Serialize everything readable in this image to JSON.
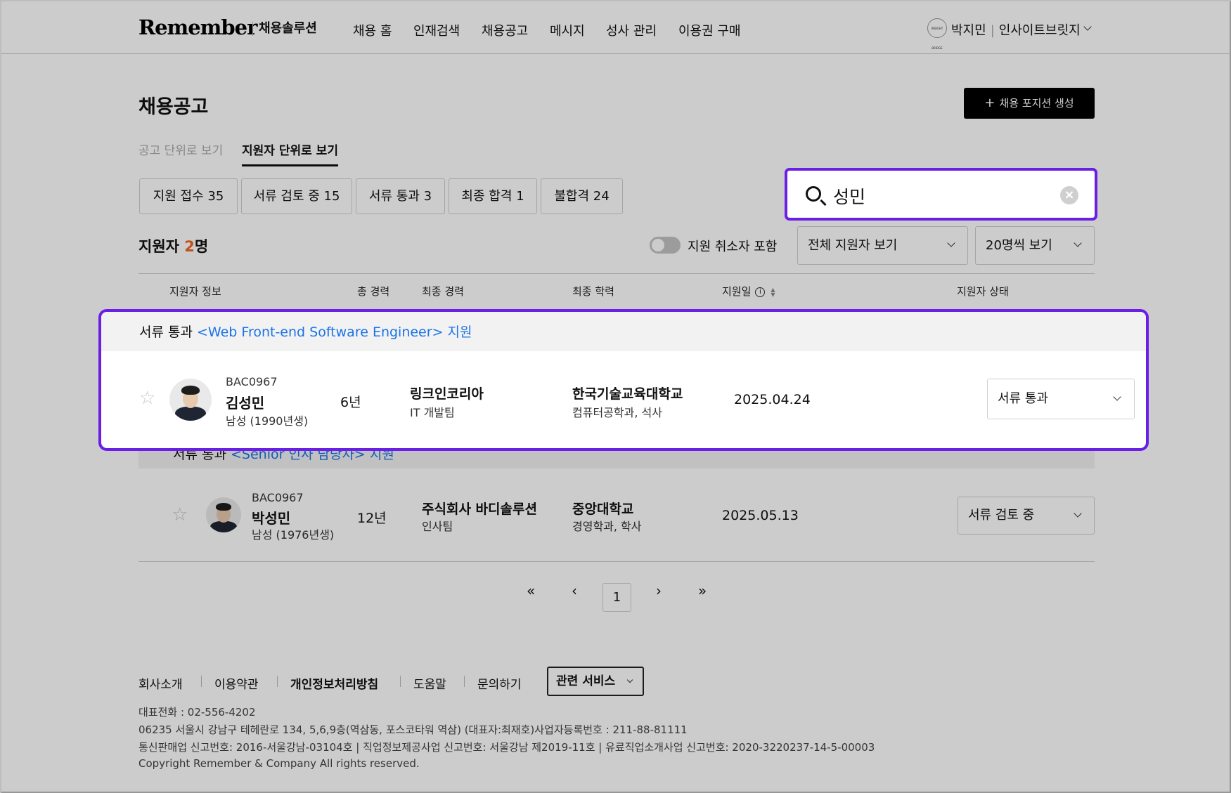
{
  "header": {
    "logo": "Remember",
    "solution": "채용솔루션",
    "nav": [
      "채용 홈",
      "인재검색",
      "채용공고",
      "메시지",
      "성사 관리",
      "이용권 구매"
    ],
    "profile": {
      "badge": "INSIGHT BRIDGE",
      "name": "박지민",
      "company": "인사이트브릿지"
    }
  },
  "page": {
    "title": "채용공고",
    "create_button": "채용 포지션 생성",
    "view_tabs": [
      "공고 단위로 보기",
      "지원자 단위로 보기"
    ],
    "active_view_tab": 1
  },
  "filters": {
    "chips": [
      "지원 접수 35",
      "서류 검토 중 15",
      "서류 통과 3",
      "최종 합격 1",
      "불합격 24"
    ]
  },
  "search": {
    "value": "성민"
  },
  "list": {
    "count_prefix": "지원자 ",
    "count": "2",
    "count_suffix": "명",
    "toggle_label": "지원 취소자 포함",
    "toggle_on": false,
    "filter_select": "전체 지원자 보기",
    "page_size_select": "20명씩 보기"
  },
  "table": {
    "headers": [
      "지원자 정보",
      "총 경력",
      "최종 경력",
      "최종 학력",
      "지원일",
      "지원자 상태"
    ],
    "groups": [
      {
        "status": "서류 통과",
        "position": "<Web Front-end Software Engineer> 지원",
        "applicant": {
          "id": "BAC0967",
          "name": "김성민",
          "profile": "남성 (1990년생)",
          "career": "6년",
          "company": "링크인코리아",
          "team": "IT 개발팀",
          "school": "한국기술교육대학교",
          "major": "컴퓨터공학과, 석사",
          "applied": "2025.04.24",
          "state": "서류 통과"
        }
      },
      {
        "status": "서류 통과",
        "position": "<Senior 인사 담당자> 지원",
        "applicant": {
          "id": "BAC0967",
          "name": "박성민",
          "profile": "남성 (1976년생)",
          "career": "12년",
          "company": "주식회사 바디솔루션",
          "team": "인사팀",
          "school": "중앙대학교",
          "major": "경영학과, 학사",
          "applied": "2025.05.13",
          "state": "서류 검토 중"
        }
      }
    ]
  },
  "pagination": {
    "first": "«",
    "prev": "‹",
    "current": "1",
    "next": "›",
    "last": "»"
  },
  "footer": {
    "links": [
      "회사소개",
      "이용약관",
      "개인정보처리방침",
      "도움말",
      "문의하기"
    ],
    "related": "관련 서비스",
    "phone": "대표전화 : 02-556-4202",
    "address": "06235 서울시 강남구 테헤란로 134, 5,6,9층(역삼동, 포스코타워 역삼) (대표자:최재호)사업자등록번호 : 211-88-81111",
    "licenses": "통신판매업 신고번호: 2016-서울강남-03104호 | 직업정보제공사업 신고번호: 서울강남 제2019-11호 | 유료직업소개사업 신고번호: 2020-3220237-14-5-00003",
    "copyright": "Copyright Remember & Company All rights reserved."
  },
  "colors": {
    "highlight": "#6a1ee6",
    "count_accent": "#f26422",
    "link": "#1a73e8"
  }
}
